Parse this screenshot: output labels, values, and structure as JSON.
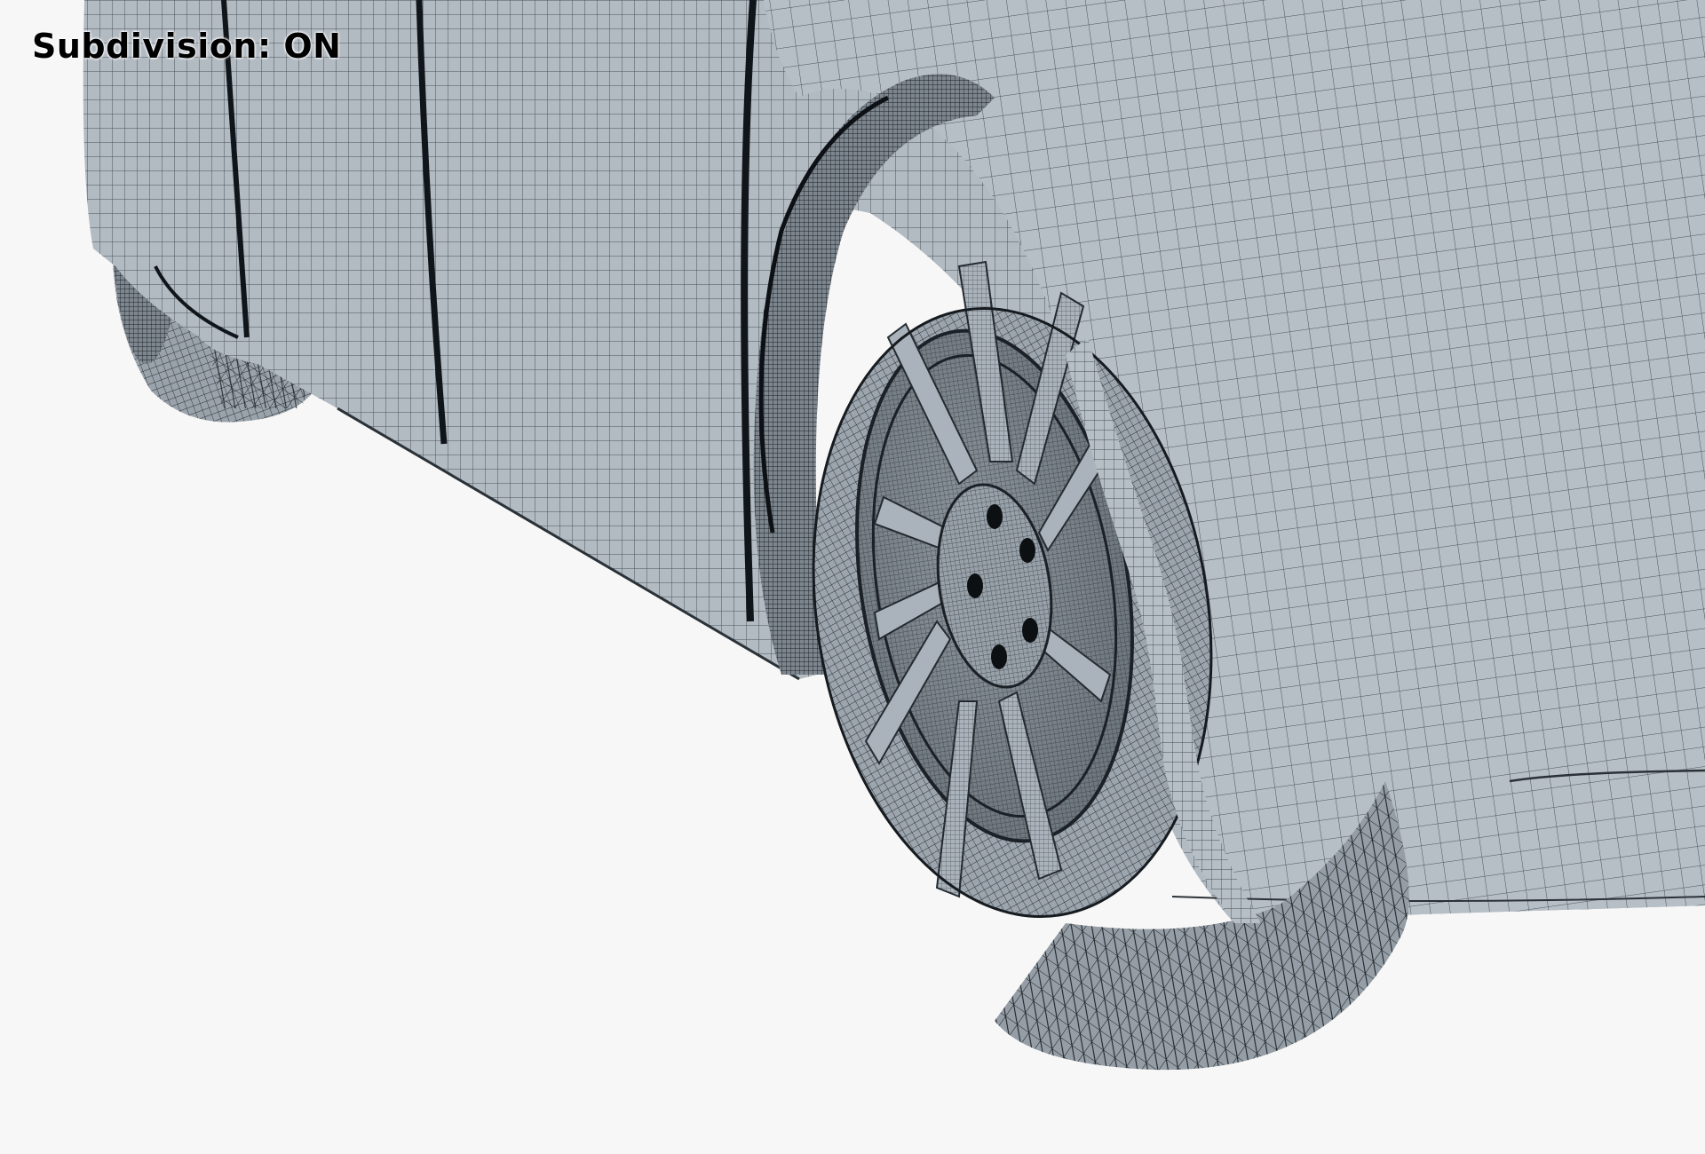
{
  "overlay": {
    "subdivision_prefix": "Subdivision: ",
    "subdivision_state": "ON"
  },
  "scene": {
    "subject": "car-rear-quarter-wireframe",
    "background_color": "#f7f7f7",
    "surface_color": "#a9b2bb",
    "wire_color": "#1f262c"
  }
}
